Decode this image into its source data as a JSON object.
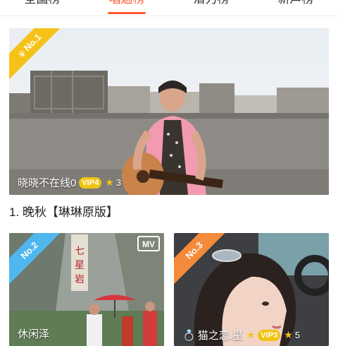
{
  "tabs": [
    {
      "label": "全国榜",
      "active": false
    },
    {
      "label": "唱遍榜",
      "active": true
    },
    {
      "label": "潜力榜",
      "active": false
    },
    {
      "label": "新声榜",
      "active": false
    }
  ],
  "featured": {
    "rank_label": "No.1",
    "user": "晓晓不在线0",
    "vip": "VIP4",
    "stars": "3",
    "song_title": "1. 晚秋【琳琳原版】"
  },
  "items": [
    {
      "rank_label": "No.2",
      "user": "休闲泽",
      "badge": "MV"
    },
    {
      "rank_label": "No.3",
      "user": "猫之恋.星",
      "vip": "VIP3",
      "stars": "5"
    }
  ],
  "colors": {
    "accent": "#ff5a2c",
    "gold": "#f5c318",
    "blue": "#4fb6ee",
    "orange": "#f48a3a"
  }
}
